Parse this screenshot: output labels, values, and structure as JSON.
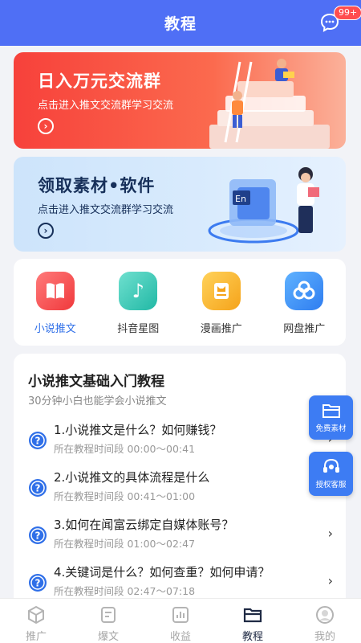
{
  "header": {
    "title": "教程",
    "badge": "99+"
  },
  "banners": [
    {
      "title": "日入万元交流群",
      "subtitle": "点击进入推文交流群学习交流"
    },
    {
      "title": "领取素材•软件",
      "subtitle": "点击进入推文交流群学习交流"
    }
  ],
  "categories": [
    {
      "label": "小说推文"
    },
    {
      "label": "抖音星图"
    },
    {
      "label": "漫画推广"
    },
    {
      "label": "网盘推广"
    }
  ],
  "tutorial": {
    "title": "小说推文基础入门教程",
    "subtitle": "30分钟小白也能学会小说推文",
    "items": [
      {
        "question": "1.小说推文是什么？如何赚钱？",
        "time": "所在教程时间段 00:00～00:41"
      },
      {
        "question": "2.小说推文的具体流程是什么",
        "time": "所在教程时间段 00:41～01:00"
      },
      {
        "question": "3.如何在闻富云绑定自媒体账号？",
        "time": "所在教程时间段 01:00～02:47"
      },
      {
        "question": "4.关键词是什么？如何查重？如何申请？",
        "time": "所在教程时间段 02:47～07:18"
      }
    ]
  },
  "floating": [
    {
      "label": "免费素材"
    },
    {
      "label": "授权客服"
    }
  ],
  "tabbar": [
    {
      "label": "推广"
    },
    {
      "label": "爆文"
    },
    {
      "label": "收益"
    },
    {
      "label": "教程"
    },
    {
      "label": "我的"
    }
  ],
  "colors": {
    "primary": "#4f6ff5",
    "accent": "#2f6fe8",
    "red_banner": "#f7413b",
    "badge": "#ff4d4f"
  }
}
